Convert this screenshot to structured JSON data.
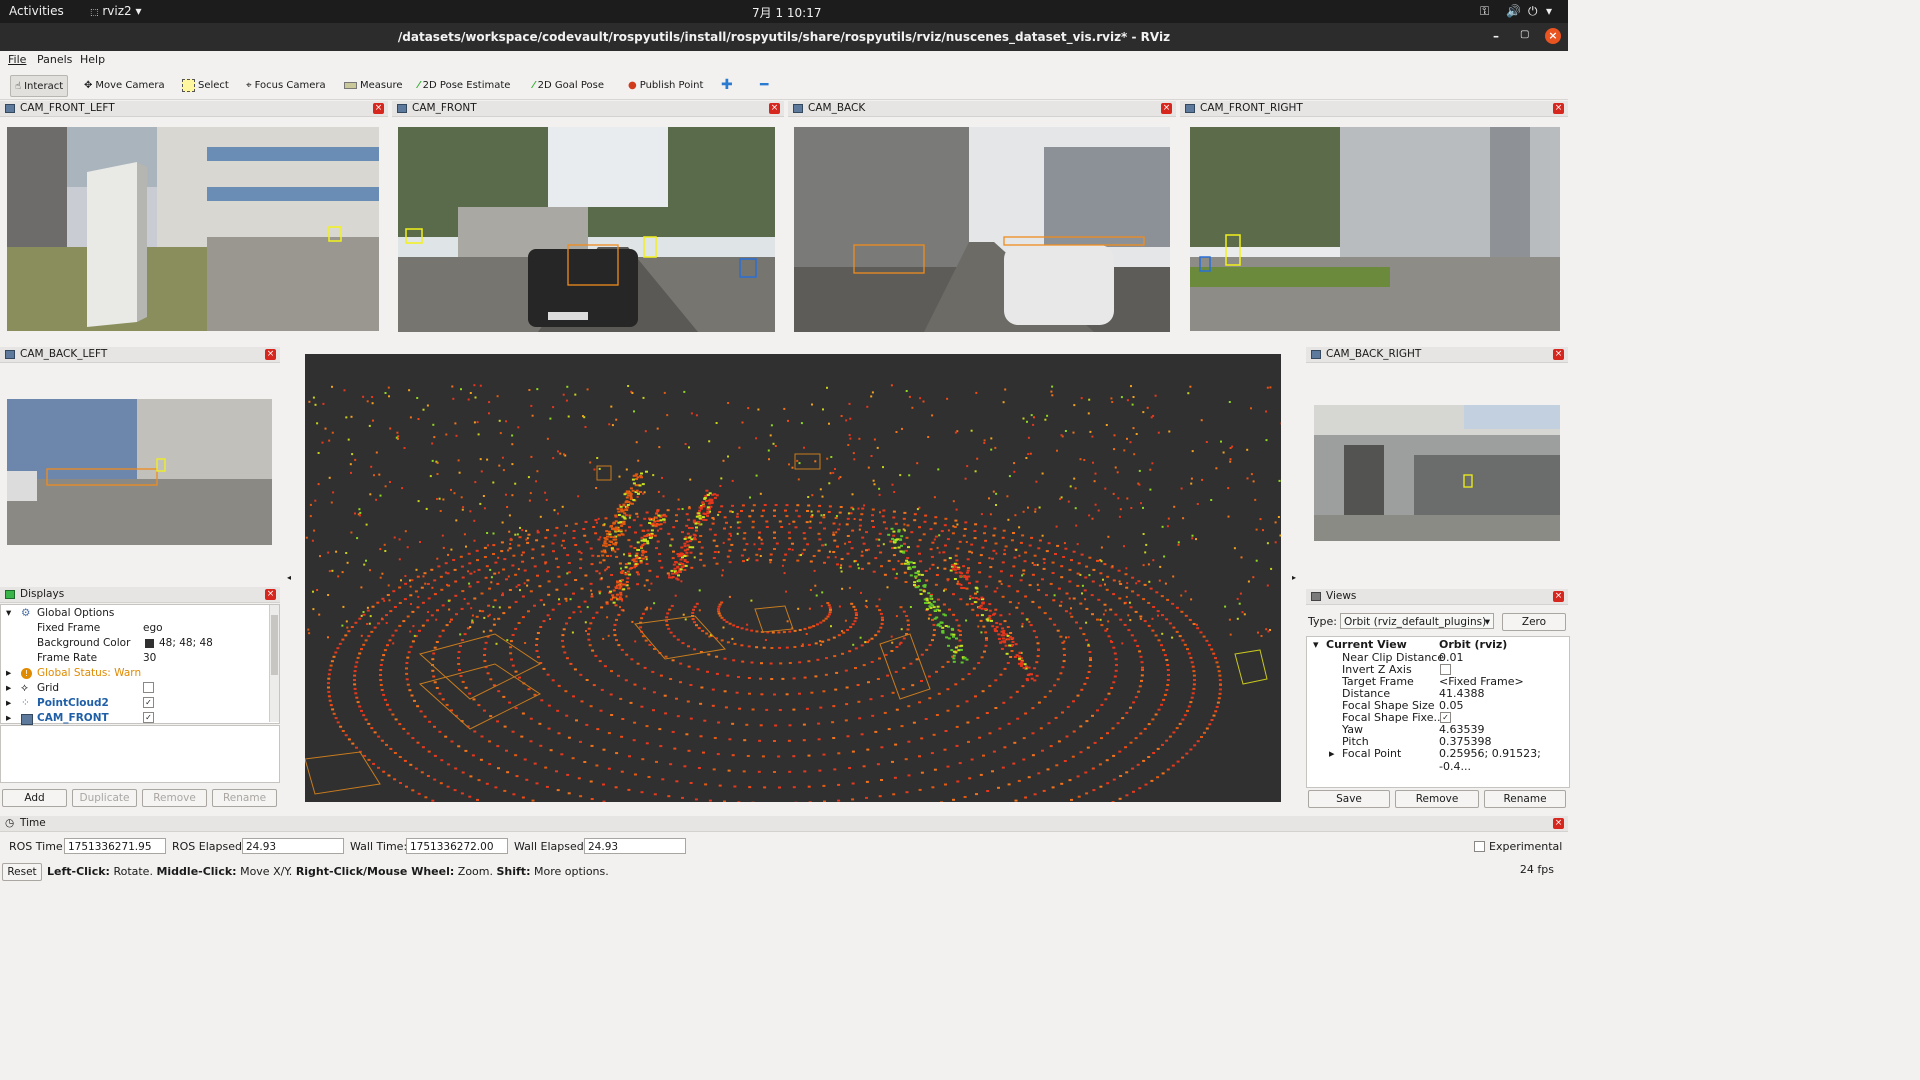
{
  "system_bar": {
    "activities": "Activities",
    "app_name": "rviz2",
    "clock": "7月 1  10:17"
  },
  "window": {
    "title": "/datasets/workspace/codevault/rospyutils/install/rospyutils/share/rospyutils/rviz/nuscenes_dataset_vis.rviz* - RViz"
  },
  "menu": {
    "file": "File",
    "panels": "Panels",
    "help": "Help"
  },
  "toolbar": {
    "interact": "Interact",
    "move_camera": "Move Camera",
    "select": "Select",
    "focus_camera": "Focus Camera",
    "measure": "Measure",
    "pose_estimate": "2D Pose Estimate",
    "goal_pose": "2D Goal Pose",
    "publish_point": "Publish Point"
  },
  "cameras": {
    "front_left": "CAM_FRONT_LEFT",
    "front": "CAM_FRONT",
    "back": "CAM_BACK",
    "front_right": "CAM_FRONT_RIGHT",
    "back_left": "CAM_BACK_LEFT",
    "back_right": "CAM_BACK_RIGHT"
  },
  "displays": {
    "title": "Displays",
    "global_options": "Global Options",
    "fixed_frame_label": "Fixed Frame",
    "fixed_frame_value": "ego",
    "bg_color_label": "Background Color",
    "bg_color_value": "48; 48; 48",
    "frame_rate_label": "Frame Rate",
    "frame_rate_value": "30",
    "global_status": "Global Status: Warn",
    "grid": "Grid",
    "pointcloud": "PointCloud2",
    "cam_front": "CAM_FRONT",
    "buttons": {
      "add": "Add",
      "duplicate": "Duplicate",
      "remove": "Remove",
      "rename": "Rename"
    }
  },
  "views": {
    "title": "Views",
    "type_label": "Type:",
    "type_value": "Orbit (rviz_default_plugins)",
    "zero": "Zero",
    "current_view_label": "Current View",
    "current_view_value": "Orbit (rviz)",
    "props": [
      {
        "k": "Near Clip Distance",
        "v": "0.01"
      },
      {
        "k": "Invert Z Axis",
        "v": ""
      },
      {
        "k": "Target Frame",
        "v": "<Fixed Frame>"
      },
      {
        "k": "Distance",
        "v": "41.4388"
      },
      {
        "k": "Focal Shape Size",
        "v": "0.05"
      },
      {
        "k": "Focal Shape Fixe...",
        "v": ""
      },
      {
        "k": "Yaw",
        "v": "4.63539"
      },
      {
        "k": "Pitch",
        "v": "0.375398"
      },
      {
        "k": "Focal Point",
        "v": "0.25956; 0.91523; -0.4..."
      }
    ],
    "buttons": {
      "save": "Save",
      "remove": "Remove",
      "rename": "Rename"
    }
  },
  "time": {
    "title": "Time",
    "ros_time_label": "ROS Time:",
    "ros_time": "1751336271.95",
    "ros_elapsed_label": "ROS Elapsed:",
    "ros_elapsed": "24.93",
    "wall_time_label": "Wall Time:",
    "wall_time": "1751336272.00",
    "wall_elapsed_label": "Wall Elapsed:",
    "wall_elapsed": "24.93",
    "experimental": "Experimental"
  },
  "statusbar": {
    "reset": "Reset",
    "k1": "Left-Click:",
    "v1": "Rotate.",
    "k2": "Middle-Click:",
    "v2": "Move X/Y.",
    "k3": "Right-Click/Mouse Wheel:",
    "v3": "Zoom.",
    "k4": "Shift:",
    "v4": "More options.",
    "fps": "24 fps"
  },
  "colors": {
    "viewport_bg": "#303030",
    "accent_blue": "#1f5fa8",
    "warn": "#e08a00"
  }
}
